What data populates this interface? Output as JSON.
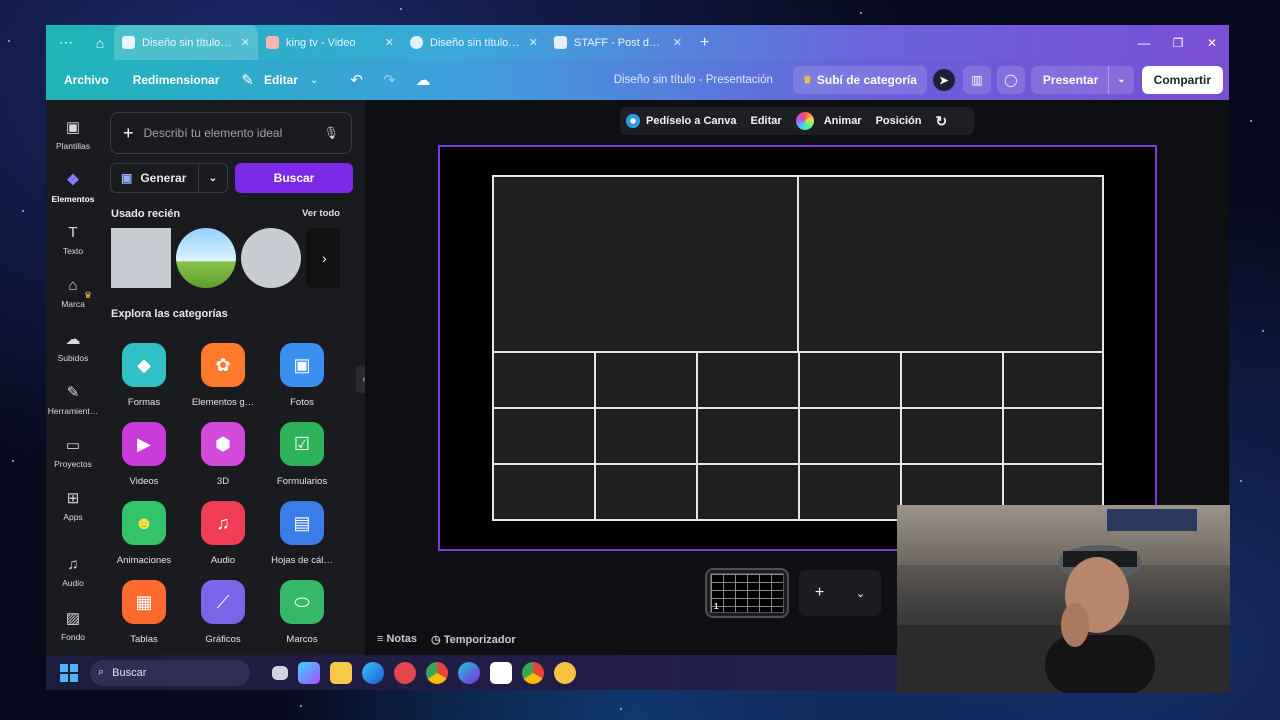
{
  "browser": {
    "tabs": [
      {
        "title": "Diseño sin título - …",
        "close": "✕"
      },
      {
        "title": "king tv - Video",
        "close": "✕"
      },
      {
        "title": "Diseño sin título - 1…",
        "close": "✕"
      },
      {
        "title": "STAFF - Post de Ins…",
        "close": "✕"
      }
    ],
    "new_tab": "+"
  },
  "toolbar": {
    "archivo": "Archivo",
    "redimensionar": "Redimensionar",
    "editar": "Editar",
    "doc_title": "Diseño sin título - Presentación",
    "upgrade": "Subí de categoría",
    "presentar": "Presentar",
    "compartir": "Compartir"
  },
  "rail": [
    {
      "label": "Plantillas",
      "icon": "template-icon"
    },
    {
      "label": "Elementos",
      "icon": "elements-icon"
    },
    {
      "label": "Texto",
      "icon": "text-icon"
    },
    {
      "label": "Marca",
      "icon": "brand-icon"
    },
    {
      "label": "Subidos",
      "icon": "upload-icon"
    },
    {
      "label": "Herramient…",
      "icon": "tools-icon"
    },
    {
      "label": "Proyectos",
      "icon": "folder-icon"
    },
    {
      "label": "Apps",
      "icon": "apps-icon"
    },
    {
      "label": "Audio",
      "icon": "music-icon"
    },
    {
      "label": "Fondo",
      "icon": "background-icon"
    }
  ],
  "panel": {
    "search_placeholder": "Describí tu elemento ideal",
    "generar": "Generar",
    "buscar": "Buscar",
    "recent_title": "Usado recién",
    "ver_todo": "Ver todo",
    "explore_title": "Explora las categorías",
    "categories": [
      {
        "label": "Formas",
        "color": "#2fc1c6"
      },
      {
        "label": "Elementos g…",
        "color": "#ff7a2d"
      },
      {
        "label": "Fotos",
        "color": "#3b8ff0"
      },
      {
        "label": "Videos",
        "color": "#c73ad8"
      },
      {
        "label": "3D",
        "color": "#d24bd8"
      },
      {
        "label": "Formularios",
        "color": "#2fb35a"
      },
      {
        "label": "Animaciones",
        "color": "#33c46a"
      },
      {
        "label": "Audio",
        "color": "#f03c55"
      },
      {
        "label": "Hojas de cál…",
        "color": "#3a7de8"
      },
      {
        "label": "Tablas",
        "color": "#ff6a2d"
      },
      {
        "label": "Gráficos",
        "color": "#7a64e8"
      },
      {
        "label": "Marcos",
        "color": "#35b868"
      }
    ]
  },
  "context_bar": {
    "pedi": "Pedíselo a Canva",
    "editar": "Editar",
    "animar": "Animar",
    "posicion": "Posición"
  },
  "pages": {
    "current": "1",
    "add": "+"
  },
  "footer": {
    "notas": "Notas",
    "temporizador": "Temporizador"
  },
  "taskbar": {
    "search": "Buscar"
  },
  "colors": {
    "accent": "#7d2ae8",
    "page_border": "#7b3bdc",
    "cell_fill": "#1f1f1f"
  }
}
